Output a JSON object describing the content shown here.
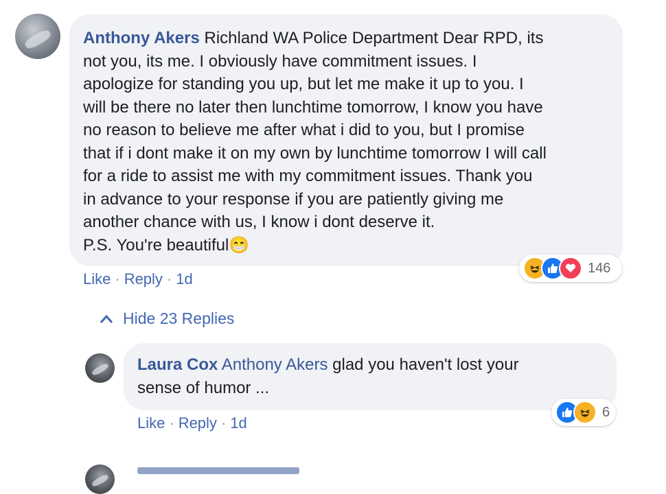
{
  "comment": {
    "author": "Anthony Akers",
    "lines": [
      "Richland WA Police Department Dear RPD, its",
      "not you, its me. I obviously have commitment issues. I",
      "apologize for standing you up, but let me make it up to you. I",
      "will be there no later then lunchtime tomorrow, I know you have",
      "no reason to believe me after what i did to you, but I promise",
      "that if i dont make it on my own by lunchtime tomorrow I will call",
      "for a ride to assist me with my commitment issues. Thank you",
      "in advance to your response if you are patiently giving me",
      "another chance with us, I know i dont deserve it.",
      "P.S. You're beautiful"
    ],
    "emoji": "😁",
    "actions": {
      "like": "Like",
      "reply": "Reply",
      "time": "1d",
      "sep": "·"
    },
    "reactions": {
      "icons": [
        "haha-icon",
        "like-icon",
        "love-icon"
      ],
      "count": "146"
    }
  },
  "hide_replies": {
    "label": "Hide 23 Replies",
    "icon": "chevron-up-icon"
  },
  "reply": {
    "author": "Laura Cox",
    "mention": "Anthony Akers",
    "lines": [
      "glad you haven't lost your",
      "sense of humor ..."
    ],
    "actions": {
      "like": "Like",
      "reply": "Reply",
      "time": "1d",
      "sep": "·"
    },
    "reactions": {
      "icons": [
        "like-icon",
        "haha-icon"
      ],
      "count": "6"
    }
  },
  "colors": {
    "link": "#385898",
    "bubble": "#f0f2f5",
    "action": "#4267b2"
  }
}
